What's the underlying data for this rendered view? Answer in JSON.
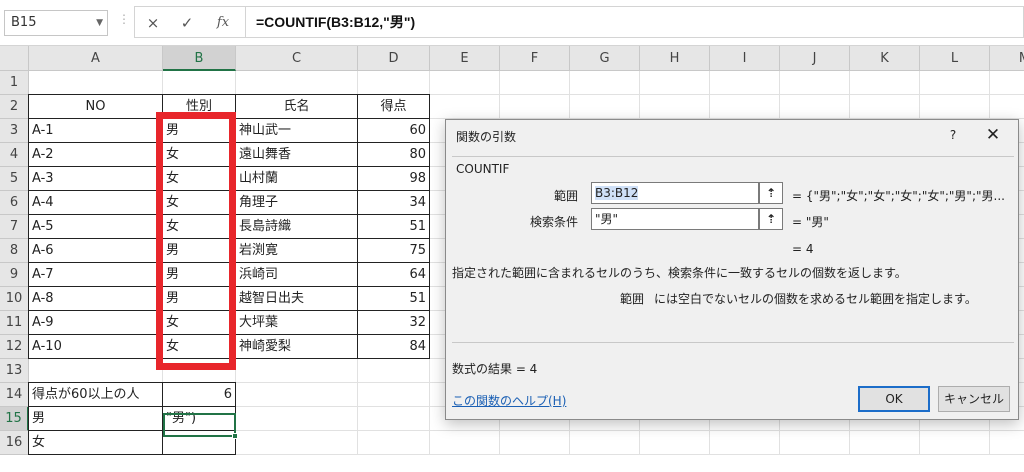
{
  "formula_bar": {
    "name_box": "B15",
    "cancel_icon": "×",
    "enter_icon": "✓",
    "fx_icon": "fx",
    "formula": "=COUNTIF(B3:B12,\"男\")"
  },
  "columns": [
    "A",
    "B",
    "C",
    "D",
    "E",
    "F",
    "G",
    "H",
    "I",
    "J",
    "K",
    "L",
    "M"
  ],
  "rows": [
    "1",
    "2",
    "3",
    "4",
    "5",
    "6",
    "7",
    "8",
    "9",
    "10",
    "11",
    "12",
    "13",
    "14",
    "15",
    "16"
  ],
  "table": {
    "headers": [
      "NO",
      "性別",
      "氏名",
      "得点"
    ],
    "records": [
      [
        "A-1",
        "男",
        "神山武一",
        "60"
      ],
      [
        "A-2",
        "女",
        "遠山舞香",
        "80"
      ],
      [
        "A-3",
        "女",
        "山村蘭",
        "98"
      ],
      [
        "A-4",
        "女",
        "角理子",
        "34"
      ],
      [
        "A-5",
        "女",
        "長島詩織",
        "51"
      ],
      [
        "A-6",
        "男",
        "岩渕寛",
        "75"
      ],
      [
        "A-7",
        "男",
        "浜崎司",
        "64"
      ],
      [
        "A-8",
        "男",
        "越智日出夫",
        "51"
      ],
      [
        "A-9",
        "女",
        "大坪葉",
        "32"
      ],
      [
        "A-10",
        "女",
        "神崎愛梨",
        "84"
      ]
    ]
  },
  "summary": {
    "label_60": "得点が60以上の人",
    "value_60": "6",
    "label_male": "男",
    "edit_text": "\"男\")",
    "label_female": "女"
  },
  "dialog": {
    "title": "関数の引数",
    "help": "?",
    "close": "✕",
    "function_name": "COUNTIF",
    "arg1_label": "範囲",
    "arg1_value": "B3:B12",
    "arg1_result": "= {\"男\";\"女\";\"女\";\"女\";\"女\";\"男\";\"男...",
    "arg2_label": "検索条件",
    "arg2_value": "\"男\"",
    "arg2_result": "= \"男\"",
    "func_result": "= 4",
    "description": "指定された範囲に含まれるセルのうち、検索条件に一致するセルの個数を返します。",
    "arg_desc_name": "範囲",
    "arg_desc": "には空白でないセルの個数を求めるセル範囲を指定します。",
    "formula_result": "数式の結果 =  4",
    "help_link": "この関数のヘルプ(H)",
    "ok": "OK",
    "cancel": "キャンセル"
  }
}
